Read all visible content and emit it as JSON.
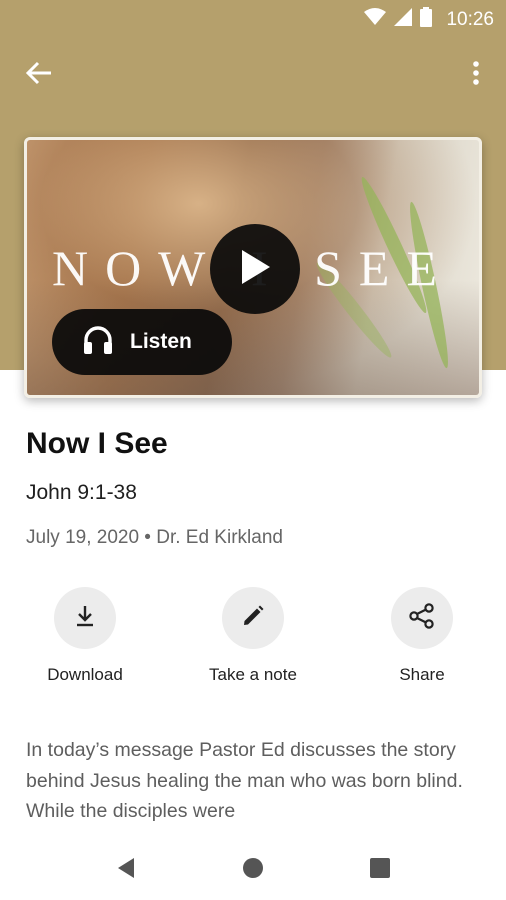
{
  "status_bar": {
    "time": "10:26"
  },
  "sermon": {
    "art_text": "NOW I SEE",
    "title": "Now I See",
    "scripture": "John 9:1-38",
    "meta": "July 19, 2020 • Dr. Ed Kirkland",
    "listen_label": "Listen"
  },
  "actions": {
    "download": "Download",
    "note": "Take a note",
    "share": "Share"
  },
  "description": "In today’s message Pastor Ed discusses the story behind Jesus healing the man who was born blind. While the disciples were",
  "colors": {
    "header": "#b5a06c",
    "button_dark": "#0a0a0a",
    "action_bg": "#ececec"
  },
  "icons": [
    "wifi-icon",
    "signal-icon",
    "battery-icon",
    "back-arrow-icon",
    "more-vert-icon",
    "play-icon",
    "headphones-icon",
    "download-icon",
    "pencil-icon",
    "share-icon",
    "nav-back-icon",
    "nav-home-icon",
    "nav-recents-icon"
  ]
}
